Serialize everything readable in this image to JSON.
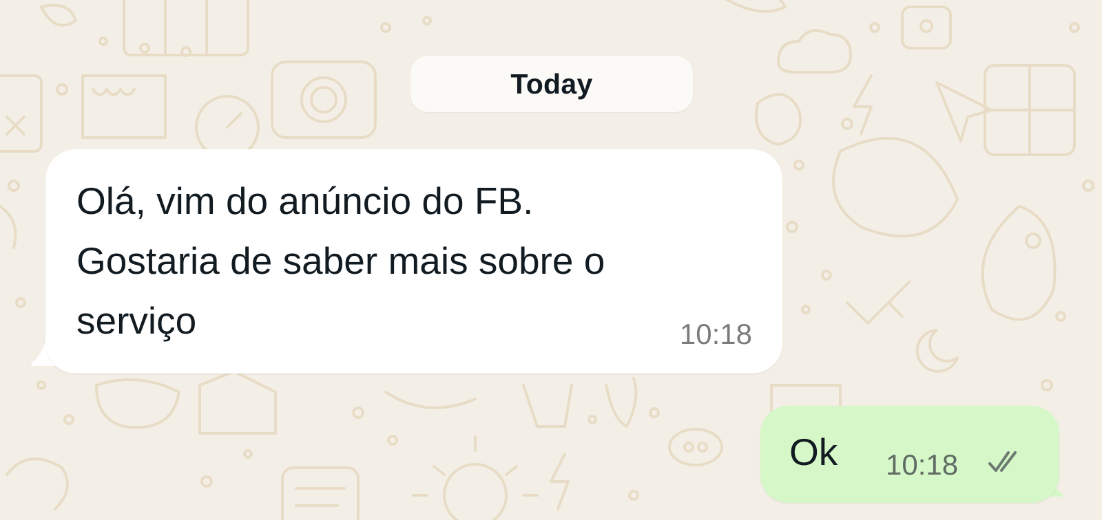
{
  "chat": {
    "date_separator": "Today",
    "messages": [
      {
        "direction": "incoming",
        "text": "Olá, vim do anúncio do FB.\nGostaria de saber mais sobre o\nserviço",
        "time": "10:18"
      },
      {
        "direction": "outgoing",
        "text": "Ok",
        "time": "10:18",
        "status_icon": "double-check-icon"
      }
    ]
  },
  "colors": {
    "background": "#f4efe6",
    "incoming_bubble": "#ffffff",
    "outgoing_bubble": "#d6f8c9",
    "doodle_stroke": "#e8dcc7"
  }
}
